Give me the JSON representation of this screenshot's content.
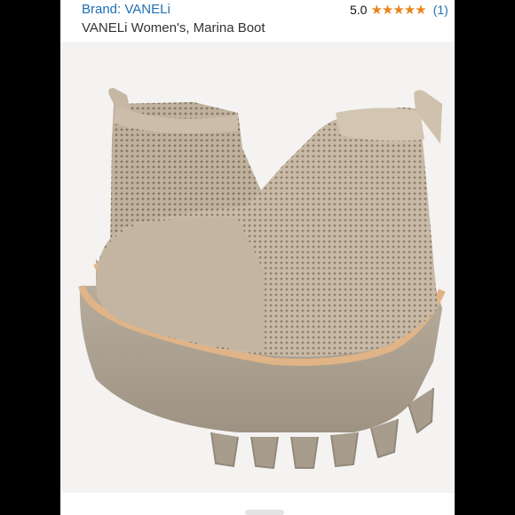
{
  "header": {
    "brand": "Brand: VANELi",
    "rating": "5.0",
    "stars": "★★★★★",
    "review_count": "(1)",
    "title": "VANELi Women's, Marina Boot"
  },
  "image": {
    "subject": "boot-photo",
    "colors": {
      "knit": "#c7b9a5",
      "sole": "#b3a898",
      "welt": "#e0b486"
    }
  }
}
